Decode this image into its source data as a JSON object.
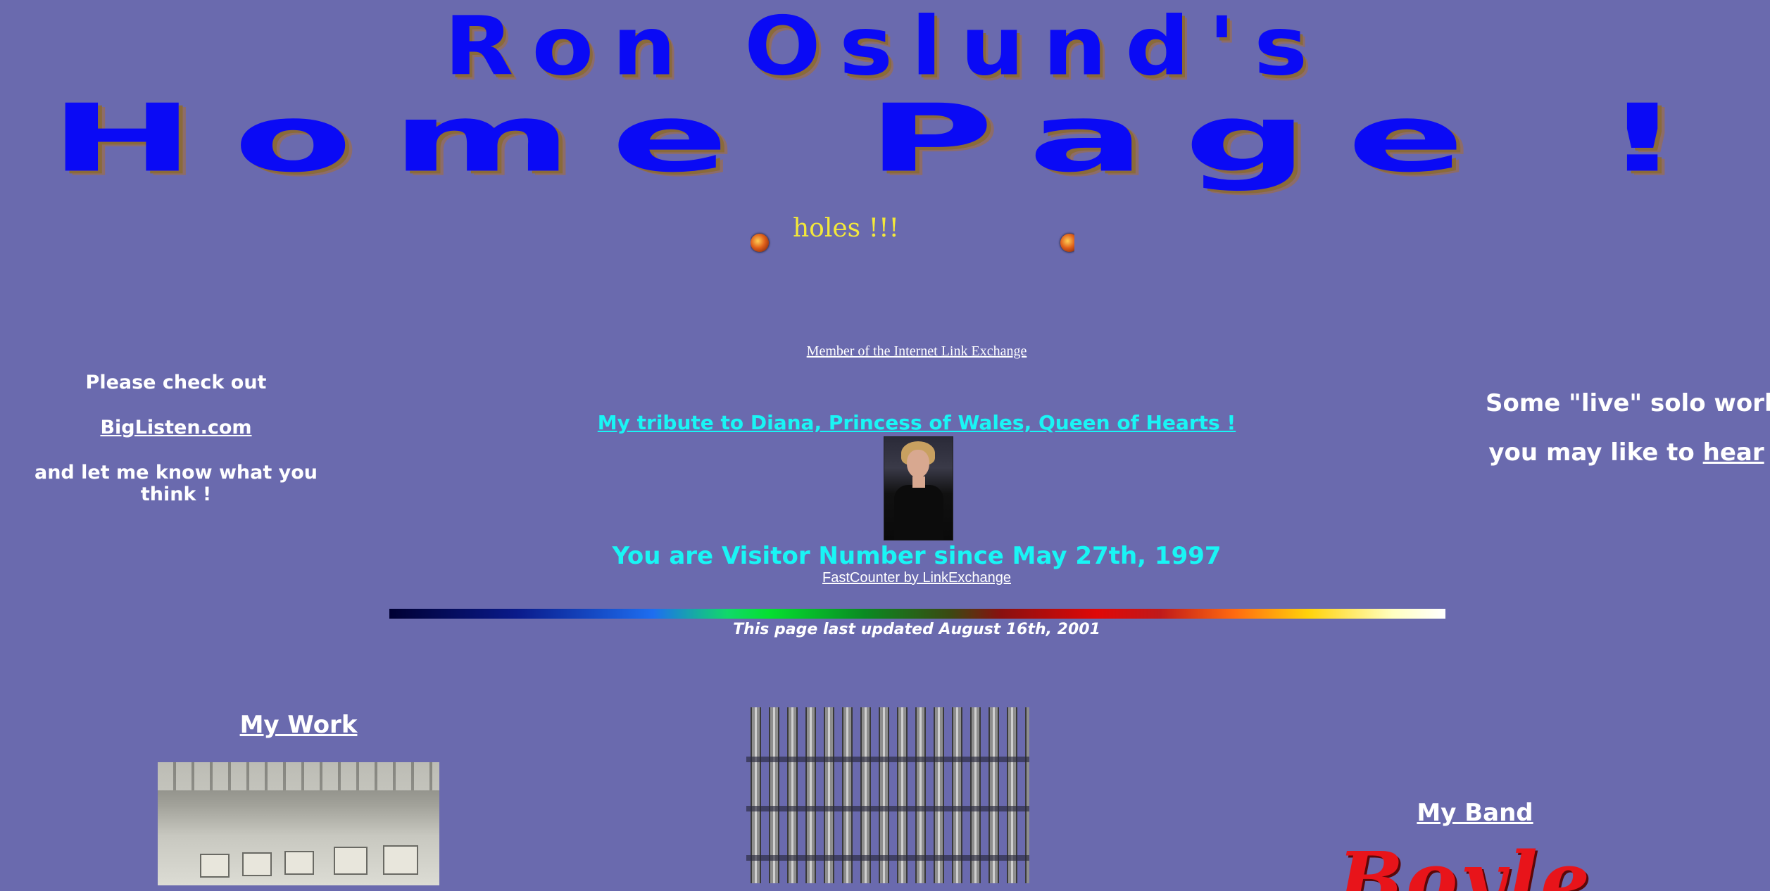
{
  "banner": {
    "line1": "Ron Oslund's",
    "line2": "Home Page !"
  },
  "marquee": {
    "text": "holes !!!"
  },
  "member_link": "Member of the Internet Link Exchange",
  "left_promo": {
    "line1": "Please check out",
    "link": "BigListen.com",
    "line3": "and let me know what you think !"
  },
  "right_promo": {
    "line1": "Some \"live\" solo work",
    "line2_prefix": "you may like to ",
    "line2_link": "hear"
  },
  "diana": {
    "link": "My tribute to Diana, Princess of Wales, Queen of Hearts !"
  },
  "visitor": {
    "text": "You are Visitor Number since May 27th, 1997",
    "counter_link": "FastCounter by LinkExchange"
  },
  "updated": "This page last updated August 16th, 2001",
  "sections": {
    "my_work": "My Work",
    "my_band": "My Band",
    "band_logo_text": "Boyle"
  },
  "colors": {
    "background": "#6a6aae",
    "banner": "#0a0af5",
    "cyan_text": "#19f5f5",
    "marquee_text": "#f3e83a",
    "band_logo": "#e8141a"
  }
}
